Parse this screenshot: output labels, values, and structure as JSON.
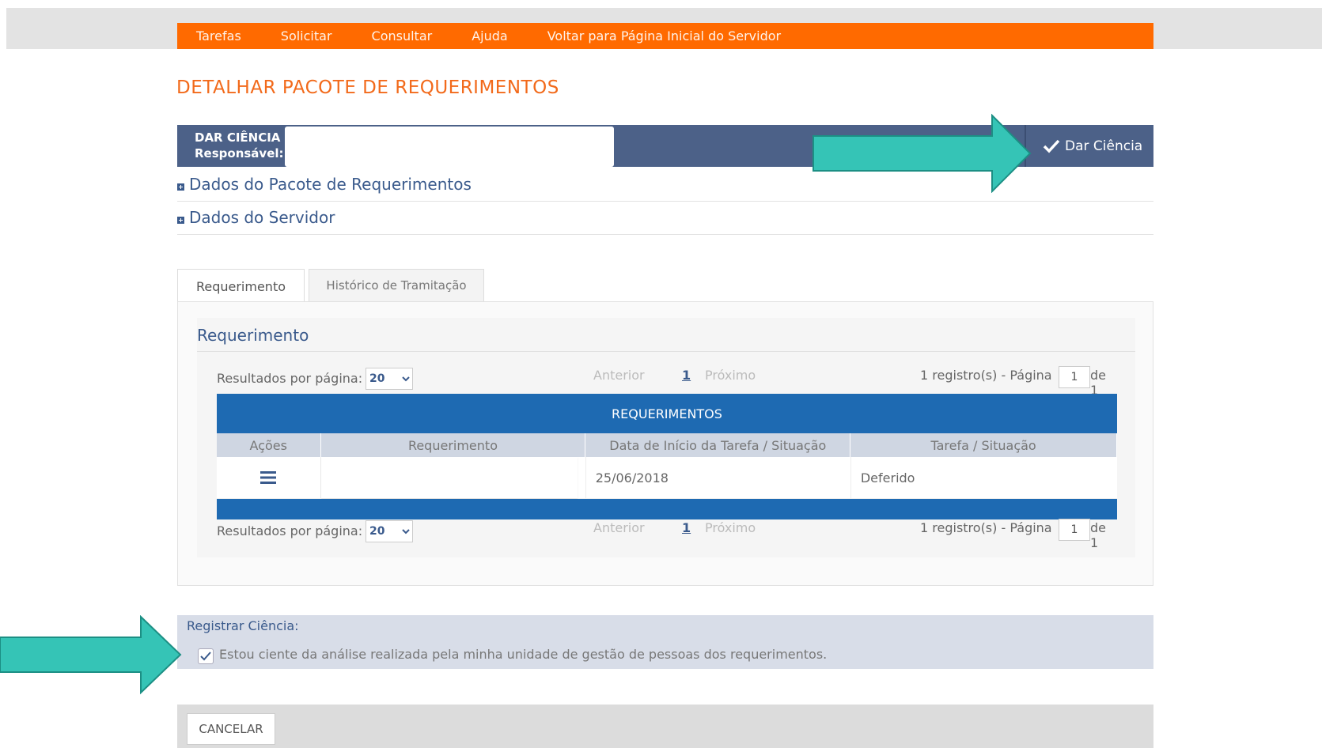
{
  "nav": {
    "items": [
      "Tarefas",
      "Solicitar",
      "Consultar",
      "Ajuda",
      "Voltar para Página Inicial do Servidor"
    ]
  },
  "page": {
    "title": "DETALHAR PACOTE DE REQUERIMENTOS"
  },
  "dar_ciencia": {
    "label": "DAR CIÊNCIA",
    "responsavel_label": "Responsável:",
    "responsavel_value": "",
    "button_label": "Dar Ciência"
  },
  "sections": {
    "pacote": "Dados do Pacote de Requerimentos",
    "servidor": "Dados do Servidor"
  },
  "tabs": {
    "active": "Requerimento",
    "inactive": "Histórico de Tramitação"
  },
  "panel": {
    "heading": "Requerimento"
  },
  "pager": {
    "rpp_label": "Resultados por página:",
    "rpp_value": "20",
    "prev": "Anterior",
    "page": "1",
    "next": "Próximo",
    "registros": "1 registro(s) - Página",
    "page_input": "1",
    "de": "de 1"
  },
  "table": {
    "caption": "REQUERIMENTOS",
    "headers": [
      "Ações",
      "Requerimento",
      "Data de Início da Tarefa / Situação",
      "Tarefa / Situação"
    ],
    "rows": [
      {
        "requerimento": "",
        "data": "25/06/2018",
        "situacao": "Deferido"
      }
    ]
  },
  "registrar": {
    "title": "Registrar Ciência:",
    "checked": true,
    "text": "Estou ciente da análise realizada pela minha unidade de gestão de pessoas dos requerimentos."
  },
  "footer": {
    "cancel": "CANCELAR"
  },
  "colors": {
    "nav": "#ff6a00",
    "title": "#f26a1b",
    "dar_bar": "#4c6188",
    "table_header": "#1e6ab2",
    "arrow": "#35c4b6"
  }
}
